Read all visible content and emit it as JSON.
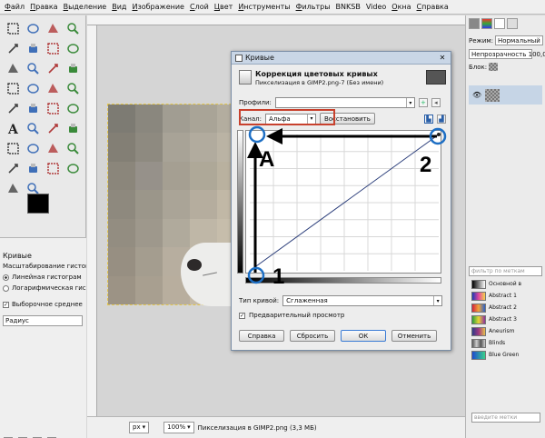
{
  "menubar": {
    "items": [
      {
        "label": "Файл",
        "u": "Ф",
        "rest": "айл"
      },
      {
        "label": "Правка",
        "u": "П",
        "rest": "равка"
      },
      {
        "label": "Выделение",
        "u": "В",
        "rest": "ыделение"
      },
      {
        "label": "Вид",
        "u": "В",
        "rest": "ид"
      },
      {
        "label": "Изображение",
        "u": "И",
        "rest": "зображение"
      },
      {
        "label": "Слой",
        "u": "С",
        "rest": "лой"
      },
      {
        "label": "Цвет",
        "u": "Ц",
        "rest": "вет"
      },
      {
        "label": "Инструменты",
        "u": "И",
        "rest": "нструменты"
      },
      {
        "label": "Фильтры",
        "u": "Ф",
        "rest": "ильтры"
      },
      {
        "label": "BNKSB",
        "u": "",
        "rest": "BNKSB"
      },
      {
        "label": "Video",
        "u": "",
        "rest": "Video"
      },
      {
        "label": "Окна",
        "u": "О",
        "rest": "кна"
      },
      {
        "label": "Справка",
        "u": "С",
        "rest": "правка"
      }
    ]
  },
  "toolbox": {
    "tools": [
      "rect-select",
      "ellipse-select",
      "free-select",
      "fuzzy-select",
      "color-select",
      "scissors",
      "foreground-select",
      "paths",
      "color-picker",
      "zoom",
      "measure",
      "move",
      "align",
      "crop",
      "rotate",
      "scale",
      "shear",
      "perspective",
      "flip",
      "cage",
      "text",
      "bucket-fill",
      "blend",
      "pencil",
      "paintbrush",
      "eraser",
      "airbrush",
      "ink",
      "clone",
      "heal",
      "perspective-clone",
      "blur",
      "smudge",
      "dodge-burn"
    ],
    "options": {
      "title": "Кривые",
      "histogram_label": "Масштабирование гистогра",
      "linear": "Линейная гистограм",
      "log": "Логарифмическая гис",
      "avg": "Выборочное среднее",
      "radius": "Радиус"
    }
  },
  "canvas": {
    "image_colors": [
      "#7d7b73",
      "#8a877e",
      "#a19d92",
      "#a9a497",
      "#b3ad9f",
      "#837f75",
      "#8e8a80",
      "#a8a397",
      "#b1ab9e",
      "#bab3a4",
      "#8b867b",
      "#96918a",
      "#a59f92",
      "#aea898",
      "#b9b19f",
      "#8e897e",
      "#9b968a",
      "#aaa497",
      "#b5ad9e",
      "#c1b8a6",
      "#938d81",
      "#9e988c",
      "#b0aa9c",
      "#bfb7a7",
      "#c6bdab",
      "#978f82",
      "#a49d8f",
      "#b7ae9f",
      "#c4baa9",
      "#cbc1ae",
      "#9c9385",
      "#a89f90",
      "#b8ae9e",
      "#c5baa7",
      "#cdc2ae"
    ]
  },
  "statusbar": {
    "unit": "px",
    "zoom": "100%",
    "text": "Пикселизация в GIMP2.png (3,3 МБ)"
  },
  "dock": {
    "mode_label": "Режим:",
    "mode_value": "Нормальный",
    "opacity_label": "Непрозрачность",
    "opacity_value": "100,0",
    "lock_label": "Блок:",
    "filter_placeholder": "фильтр по меткам",
    "search_placeholder": "введите метки",
    "brushes": [
      {
        "name": "Основной в",
        "color": "linear-gradient(to right,#000,#fff)"
      },
      {
        "name": "Abstract 1",
        "color": "linear-gradient(to right,#1c3ab5,#e5479e,#f3d34c)"
      },
      {
        "name": "Abstract 2",
        "color": "linear-gradient(to right,#d2223d,#f2a53a,#2b62c9)"
      },
      {
        "name": "Abstract 3",
        "color": "linear-gradient(to right,#2a9d3c,#e8d636,#8d2f9e)"
      },
      {
        "name": "Aneurism",
        "color": "linear-gradient(to right,#2d3c88,#a03880,#e6c04c)"
      },
      {
        "name": "Blinds",
        "color": "linear-gradient(to right,#555,#ccc,#555,#ccc)"
      },
      {
        "name": "Blue Green",
        "color": "linear-gradient(to right,#1e4ad0,#3ad18a)"
      }
    ]
  },
  "dialog": {
    "window_title": "Кривые",
    "heading": "Коррекция цветовых кривых",
    "subtitle": "Пикселизация в GIMP2.png-7 (Без имени)",
    "profiles_label": "Профили:",
    "channel_label": "Канал:",
    "channel_value": "Альфа",
    "reset_channel": "Восстановить",
    "curve_type_label": "Тип кривой:",
    "curve_type_value": "Сглаженная",
    "preview_label": "Предварительный просмотр",
    "buttons": {
      "help": "Справка",
      "reset": "Сбросить",
      "ok": "ОК",
      "cancel": "Отменить"
    }
  },
  "annotations": {
    "label_a": "A",
    "label_1": "1",
    "label_2": "2",
    "accent": "#1e6fc4",
    "red": "#c8412d"
  }
}
